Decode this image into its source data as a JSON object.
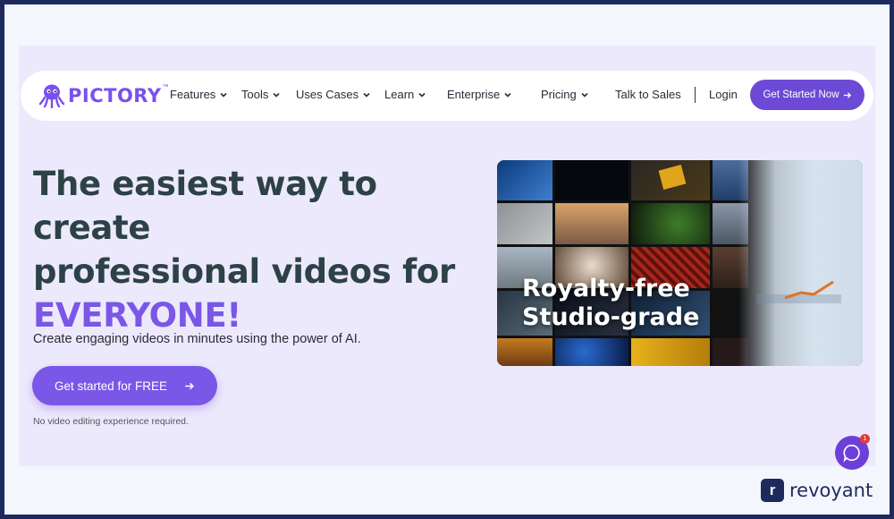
{
  "header": {
    "brand": "PICTORY",
    "brand_mark": "™",
    "nav_items": [
      {
        "label": "Features",
        "has_dropdown": true
      },
      {
        "label": "Tools",
        "has_dropdown": true
      },
      {
        "label": "Uses Cases",
        "has_dropdown": true
      },
      {
        "label": "Learn",
        "has_dropdown": true
      },
      {
        "label": "Enterprise",
        "has_dropdown": true
      },
      {
        "label": "Pricing",
        "has_dropdown": true
      }
    ],
    "talk_to_sales": "Talk to Sales",
    "login": "Login",
    "cta": "Get Started Now",
    "cta_icon": "arrow-right-icon"
  },
  "hero": {
    "headline_line1": "The easiest way to create",
    "headline_line2": "professional videos for",
    "headline_accent": "EVERYONE!",
    "subtext": "Create engaging videos in minutes using the power of AI.",
    "cta": "Get started for FREE",
    "cta_icon": "arrow-right-icon",
    "note": "No video editing experience required.",
    "media_caption_line1": "Royalty-free",
    "media_caption_line2": "Studio-grade"
  },
  "chat_widget": {
    "icon": "chat-icon",
    "badge": "1"
  },
  "watermark": {
    "letter": "r",
    "text": "revoyant"
  },
  "colors": {
    "accent": "#7a57e6",
    "brand": "#7a4ff0",
    "nav_cta": "#6c4ad6",
    "panel_bg": "#ede9fd",
    "heading": "#2d4246"
  }
}
